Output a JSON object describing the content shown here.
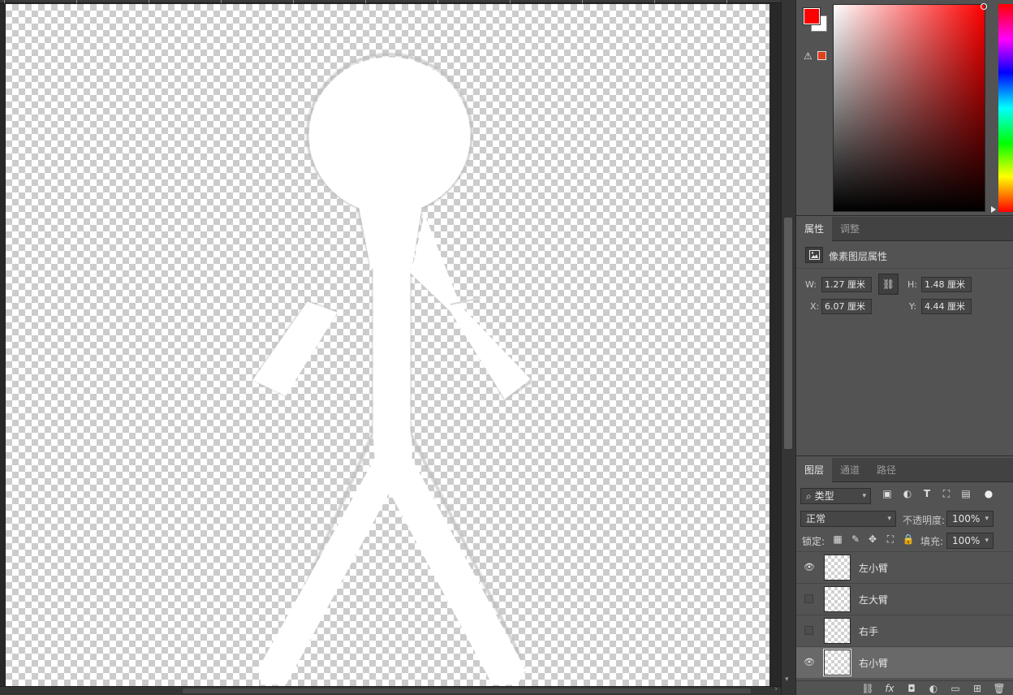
{
  "colors": {
    "foreground": "#ff0000",
    "background": "#ffffff",
    "gamut_warning": "#e0401a",
    "panel_bg": "#535353",
    "workspace_bg": "#282828"
  },
  "color_panel": {
    "icons": [
      "foreground-swatch",
      "background-swatch",
      "warning-icon",
      "gamut-swatch",
      "saturation-brightness-field",
      "hue-bar"
    ]
  },
  "properties_panel": {
    "tabs": [
      {
        "label": "属性",
        "active": true
      },
      {
        "label": "调整",
        "active": false
      }
    ],
    "title": "像素图层属性",
    "w_label": "W:",
    "w_value": "1.27 厘米",
    "h_label": "H:",
    "h_value": "1.48 厘米",
    "x_label": "X:",
    "x_value": "6.07 厘米",
    "y_label": "Y:",
    "y_value": "4.44 厘米",
    "link_icon": "link-icon"
  },
  "layers_panel": {
    "tabs": [
      {
        "label": "图层",
        "active": true
      },
      {
        "label": "通道",
        "active": false
      },
      {
        "label": "路径",
        "active": false
      }
    ],
    "filter_kind": "类型",
    "filter_icons": [
      "image-filter-icon",
      "adjustment-filter-icon",
      "type-filter-icon",
      "shape-filter-icon",
      "smart-object-filter-icon",
      "filter-toggle-icon"
    ],
    "blend_mode": "正常",
    "opacity_label": "不透明度:",
    "opacity_value": "100%",
    "lock_label": "锁定:",
    "lock_icons": [
      "lock-transparent-icon",
      "lock-image-icon",
      "lock-position-icon",
      "lock-artboard-icon",
      "lock-all-icon"
    ],
    "fill_label": "填充:",
    "fill_value": "100%",
    "layers": [
      {
        "name": "左小臂",
        "visible": true,
        "selected": false
      },
      {
        "name": "左大臂",
        "visible": false,
        "selected": false
      },
      {
        "name": "右手",
        "visible": false,
        "selected": false
      },
      {
        "name": "右小臂",
        "visible": true,
        "selected": true
      }
    ],
    "footer_icons": [
      "link-layers-icon",
      "fx-icon",
      "mask-icon",
      "adjustment-layer-icon",
      "group-folder-icon",
      "new-layer-icon",
      "delete-icon"
    ]
  }
}
